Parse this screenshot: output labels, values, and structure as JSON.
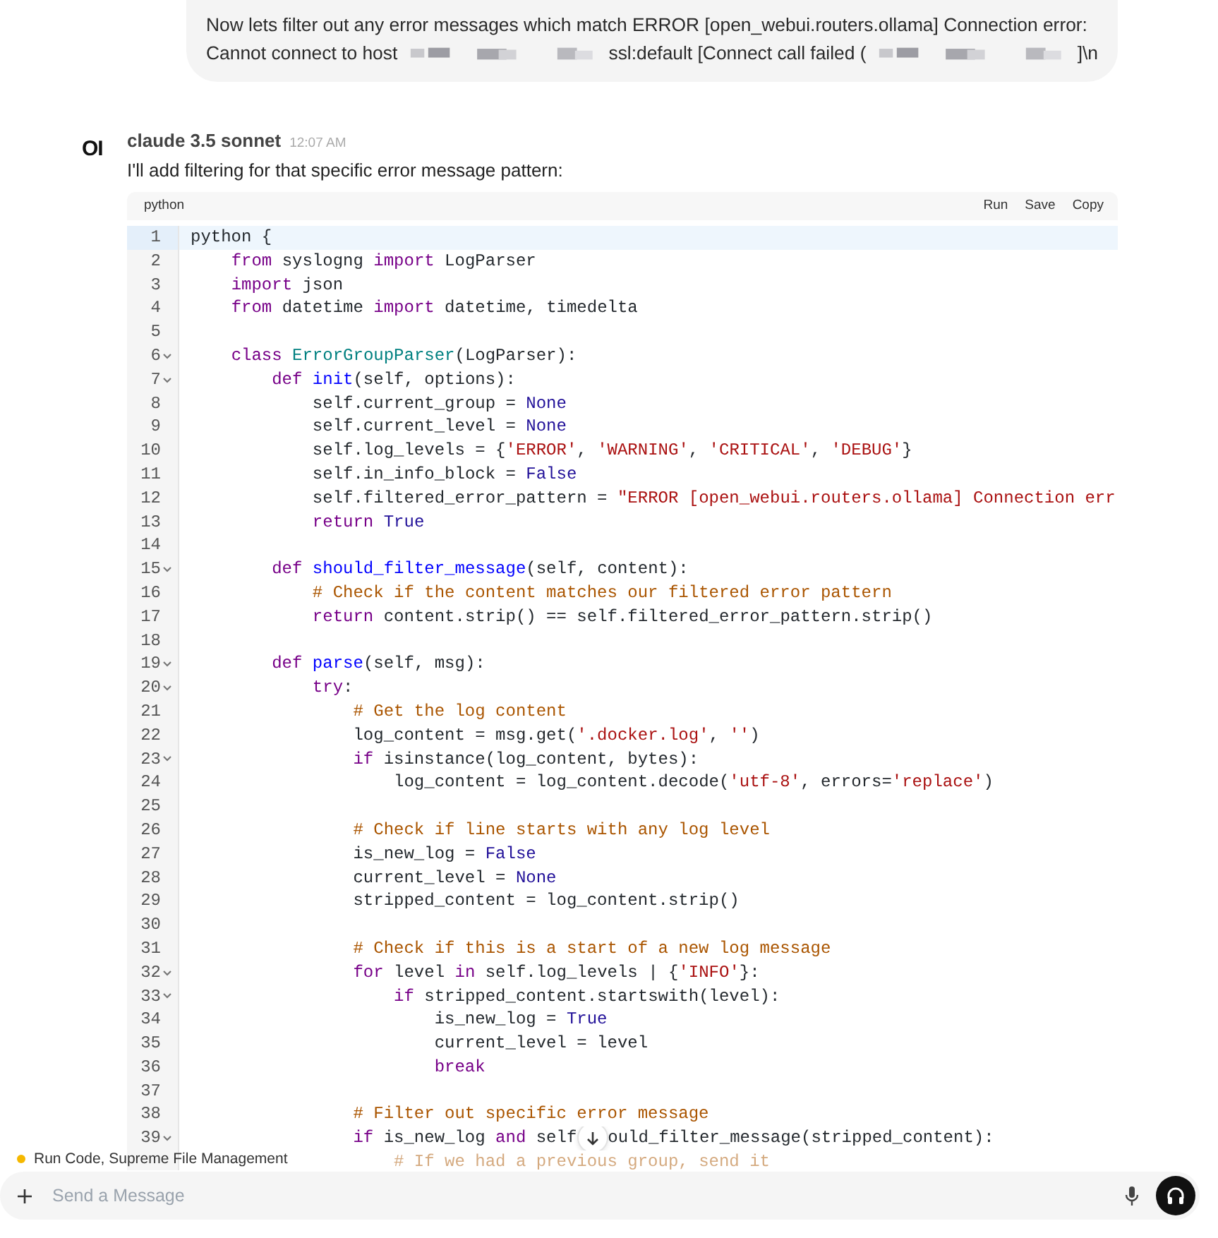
{
  "user_message": {
    "lines": [
      [
        {
          "kind": "text",
          "text": "Now lets filter out any error messages which match ERROR [open_webui.routers.ollama] Connection error:"
        }
      ],
      [
        {
          "kind": "text",
          "text": "Cannot connect to host"
        },
        {
          "kind": "redacted"
        },
        {
          "kind": "text",
          "text": "ssl:default [Connect call failed ("
        },
        {
          "kind": "redacted"
        },
        {
          "kind": "text",
          "text": "]\\n"
        }
      ]
    ]
  },
  "assistant": {
    "logo": "OI",
    "model": "claude 3.5 sonnet",
    "time": "12:07 AM",
    "intro": "I'll add filtering for that specific error message pattern:"
  },
  "code_block": {
    "language": "python",
    "actions": [
      "Run",
      "Save",
      "Copy"
    ],
    "lines": [
      {
        "n": "1",
        "fold": false,
        "active": true,
        "tokens": [
          {
            "kind": "plain",
            "text": "python {"
          }
        ]
      },
      {
        "n": "2",
        "fold": false,
        "active": false,
        "tokens": [
          {
            "kind": "keyword",
            "text": "    from"
          },
          {
            "kind": "plain",
            "text": " syslogng "
          },
          {
            "kind": "keyword",
            "text": "import"
          },
          {
            "kind": "plain",
            "text": " LogParser"
          }
        ]
      },
      {
        "n": "3",
        "fold": false,
        "active": false,
        "tokens": [
          {
            "kind": "keyword",
            "text": "    import"
          },
          {
            "kind": "plain",
            "text": " json"
          }
        ]
      },
      {
        "n": "4",
        "fold": false,
        "active": false,
        "tokens": [
          {
            "kind": "keyword",
            "text": "    from"
          },
          {
            "kind": "plain",
            "text": " datetime "
          },
          {
            "kind": "keyword",
            "text": "import"
          },
          {
            "kind": "plain",
            "text": " datetime, timedelta"
          }
        ]
      },
      {
        "n": "5",
        "fold": false,
        "active": false
      },
      {
        "n": "6",
        "fold": true,
        "active": false,
        "tokens": [
          {
            "kind": "keyword",
            "text": "    class "
          },
          {
            "kind": "class",
            "text": "ErrorGroupParser"
          },
          {
            "kind": "plain",
            "text": "(LogParser):"
          }
        ]
      },
      {
        "n": "7",
        "fold": true,
        "active": false,
        "tokens": [
          {
            "kind": "keyword",
            "text": "        def "
          },
          {
            "kind": "function",
            "text": "init"
          },
          {
            "kind": "plain",
            "text": "(self, options):"
          }
        ]
      },
      {
        "n": "8",
        "fold": false,
        "active": false,
        "tokens": [
          {
            "kind": "plain",
            "text": "            self.current_group = "
          },
          {
            "kind": "atom",
            "text": "None"
          }
        ]
      },
      {
        "n": "9",
        "fold": false,
        "active": false,
        "tokens": [
          {
            "kind": "plain",
            "text": "            self.current_level = "
          },
          {
            "kind": "atom",
            "text": "None"
          }
        ]
      },
      {
        "n": "10",
        "fold": false,
        "active": false,
        "tokens": [
          {
            "kind": "plain",
            "text": "            self.log_levels = {"
          },
          {
            "kind": "string",
            "text": "'ERROR'"
          },
          {
            "kind": "plain",
            "text": ", "
          },
          {
            "kind": "string",
            "text": "'WARNING'"
          },
          {
            "kind": "plain",
            "text": ", "
          },
          {
            "kind": "string",
            "text": "'CRITICAL'"
          },
          {
            "kind": "plain",
            "text": ", "
          },
          {
            "kind": "string",
            "text": "'DEBUG'"
          },
          {
            "kind": "plain",
            "text": "}"
          }
        ]
      },
      {
        "n": "11",
        "fold": false,
        "active": false,
        "tokens": [
          {
            "kind": "plain",
            "text": "            self.in_info_block = "
          },
          {
            "kind": "atom",
            "text": "False"
          }
        ]
      },
      {
        "n": "12",
        "fold": false,
        "active": false,
        "tokens": [
          {
            "kind": "plain",
            "text": "            self.filtered_error_pattern = "
          },
          {
            "kind": "string",
            "text": "\"ERROR [open_webui.routers.ollama] Connection err"
          }
        ]
      },
      {
        "n": "13",
        "fold": false,
        "active": false,
        "tokens": [
          {
            "kind": "keyword",
            "text": "            return "
          },
          {
            "kind": "atom",
            "text": "True"
          }
        ]
      },
      {
        "n": "14",
        "fold": false,
        "active": false
      },
      {
        "n": "15",
        "fold": true,
        "active": false,
        "tokens": [
          {
            "kind": "keyword",
            "text": "        def "
          },
          {
            "kind": "function",
            "text": "should_filter_message"
          },
          {
            "kind": "plain",
            "text": "(self, content):"
          }
        ]
      },
      {
        "n": "16",
        "fold": false,
        "active": false,
        "tokens": [
          {
            "kind": "comment",
            "text": "            # Check if the content matches our filtered error pattern"
          }
        ]
      },
      {
        "n": "17",
        "fold": false,
        "active": false,
        "tokens": [
          {
            "kind": "keyword",
            "text": "            return"
          },
          {
            "kind": "plain",
            "text": " content.strip() == self.filtered_error_pattern.strip()"
          }
        ]
      },
      {
        "n": "18",
        "fold": false,
        "active": false
      },
      {
        "n": "19",
        "fold": true,
        "active": false,
        "tokens": [
          {
            "kind": "keyword",
            "text": "        def "
          },
          {
            "kind": "function",
            "text": "parse"
          },
          {
            "kind": "plain",
            "text": "(self, msg):"
          }
        ]
      },
      {
        "n": "20",
        "fold": true,
        "active": false,
        "tokens": [
          {
            "kind": "keyword",
            "text": "            try"
          },
          {
            "kind": "plain",
            "text": ":"
          }
        ]
      },
      {
        "n": "21",
        "fold": false,
        "active": false,
        "tokens": [
          {
            "kind": "comment",
            "text": "                # Get the log content"
          }
        ]
      },
      {
        "n": "22",
        "fold": false,
        "active": false,
        "tokens": [
          {
            "kind": "plain",
            "text": "                log_content = msg.get("
          },
          {
            "kind": "string",
            "text": "'.docker.log'"
          },
          {
            "kind": "plain",
            "text": ", "
          },
          {
            "kind": "string",
            "text": "''"
          },
          {
            "kind": "plain",
            "text": ")"
          }
        ]
      },
      {
        "n": "23",
        "fold": true,
        "active": false,
        "tokens": [
          {
            "kind": "keyword",
            "text": "                if"
          },
          {
            "kind": "plain",
            "text": " isinstance(log_content, bytes):"
          }
        ]
      },
      {
        "n": "24",
        "fold": false,
        "active": false,
        "tokens": [
          {
            "kind": "plain",
            "text": "                    log_content = log_content.decode("
          },
          {
            "kind": "string",
            "text": "'utf-8'"
          },
          {
            "kind": "plain",
            "text": ", errors="
          },
          {
            "kind": "string",
            "text": "'replace'"
          },
          {
            "kind": "plain",
            "text": ")"
          }
        ]
      },
      {
        "n": "25",
        "fold": false,
        "active": false
      },
      {
        "n": "26",
        "fold": false,
        "active": false,
        "tokens": [
          {
            "kind": "comment",
            "text": "                # Check if line starts with any log level"
          }
        ]
      },
      {
        "n": "27",
        "fold": false,
        "active": false,
        "tokens": [
          {
            "kind": "plain",
            "text": "                is_new_log = "
          },
          {
            "kind": "atom",
            "text": "False"
          }
        ]
      },
      {
        "n": "28",
        "fold": false,
        "active": false,
        "tokens": [
          {
            "kind": "plain",
            "text": "                current_level = "
          },
          {
            "kind": "atom",
            "text": "None"
          }
        ]
      },
      {
        "n": "29",
        "fold": false,
        "active": false,
        "tokens": [
          {
            "kind": "plain",
            "text": "                stripped_content = log_content.strip()"
          }
        ]
      },
      {
        "n": "30",
        "fold": false,
        "active": false
      },
      {
        "n": "31",
        "fold": false,
        "active": false,
        "tokens": [
          {
            "kind": "comment",
            "text": "                # Check if this is a start of a new log message"
          }
        ]
      },
      {
        "n": "32",
        "fold": true,
        "active": false,
        "tokens": [
          {
            "kind": "keyword",
            "text": "                for"
          },
          {
            "kind": "plain",
            "text": " level "
          },
          {
            "kind": "keyword",
            "text": "in"
          },
          {
            "kind": "plain",
            "text": " self.log_levels | {"
          },
          {
            "kind": "string",
            "text": "'INFO'"
          },
          {
            "kind": "plain",
            "text": "}:"
          }
        ]
      },
      {
        "n": "33",
        "fold": true,
        "active": false,
        "tokens": [
          {
            "kind": "keyword",
            "text": "                    if"
          },
          {
            "kind": "plain",
            "text": " stripped_content.startswith(level):"
          }
        ]
      },
      {
        "n": "34",
        "fold": false,
        "active": false,
        "tokens": [
          {
            "kind": "plain",
            "text": "                        is_new_log = "
          },
          {
            "kind": "atom",
            "text": "True"
          }
        ]
      },
      {
        "n": "35",
        "fold": false,
        "active": false,
        "tokens": [
          {
            "kind": "plain",
            "text": "                        current_level = level"
          }
        ]
      },
      {
        "n": "36",
        "fold": false,
        "active": false,
        "tokens": [
          {
            "kind": "keyword",
            "text": "                        break"
          }
        ]
      },
      {
        "n": "37",
        "fold": false,
        "active": false
      },
      {
        "n": "38",
        "fold": false,
        "active": false,
        "tokens": [
          {
            "kind": "comment",
            "text": "                # Filter out specific error message"
          }
        ]
      },
      {
        "n": "39",
        "fold": true,
        "active": false,
        "tokens": [
          {
            "kind": "keyword",
            "text": "                if"
          },
          {
            "kind": "plain",
            "text": " is_new_log "
          },
          {
            "kind": "keyword",
            "text": "and"
          },
          {
            "kind": "plain",
            "text": " self"
          },
          {
            "kind": "covered"
          },
          {
            "kind": "plain",
            "text": "ould_filter_message(stripped_content):"
          }
        ]
      },
      {
        "faded": true,
        "tokens": [
          {
            "kind": "comment",
            "text": "                    # If we had a previous group, send it"
          }
        ]
      }
    ]
  },
  "status": {
    "text": "Run Code, Supreme File Management",
    "color": "#f5b800"
  },
  "composer": {
    "placeholder": "Send a Message"
  }
}
